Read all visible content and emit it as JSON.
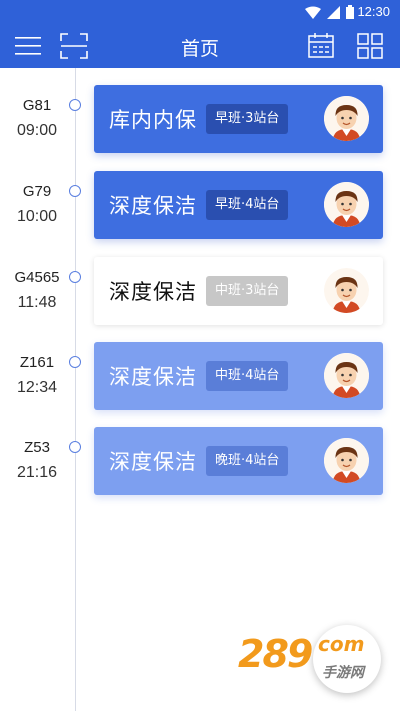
{
  "status_bar": {
    "time": "12:30"
  },
  "app_bar": {
    "title": "首页"
  },
  "schedule": [
    {
      "train": "G81",
      "time": "09:00",
      "task": "库内内保",
      "shift": "早班·3站台",
      "state": "active"
    },
    {
      "train": "G79",
      "time": "10:00",
      "task": "深度保洁",
      "shift": "早班·4站台",
      "state": "active"
    },
    {
      "train": "G4565",
      "time": "11:48",
      "task": "深度保洁",
      "shift": "中班·3站台",
      "state": "inactive"
    },
    {
      "train": "Z161",
      "time": "12:34",
      "task": "深度保洁",
      "shift": "中班·4站台",
      "state": "faded"
    },
    {
      "train": "Z53",
      "time": "21:16",
      "task": "深度保洁",
      "shift": "晚班·4站台",
      "state": "faded"
    }
  ],
  "watermark": {
    "main": "289",
    "domain": "com",
    "sub": "手游网"
  },
  "colors": {
    "primary": "#2f61d8",
    "card_active": "#3e6ee0",
    "card_faded": "#7d9ff0",
    "accent": "#f29a1c"
  }
}
